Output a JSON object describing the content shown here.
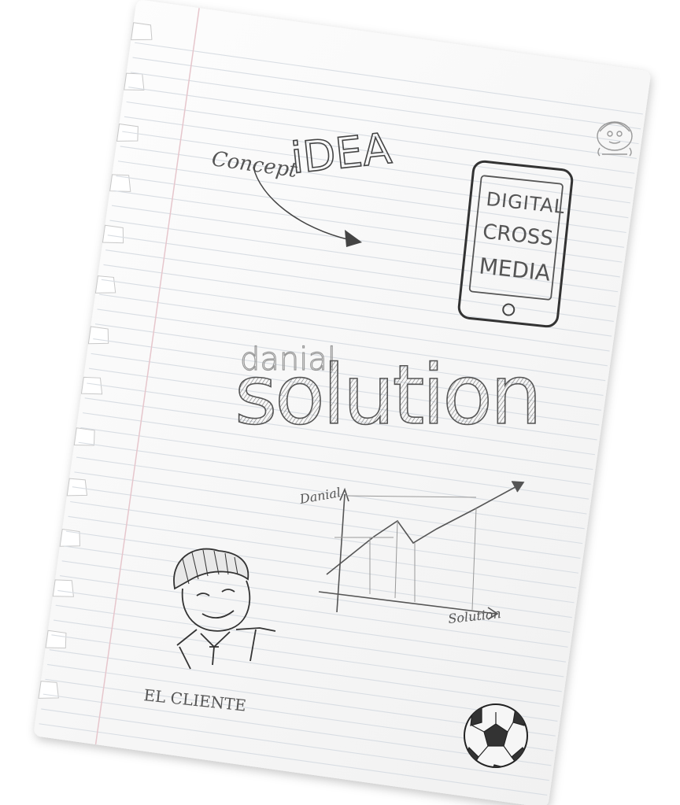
{
  "sheet": {
    "paper_color": "#fbfbfb",
    "rule_color": "#d8dde3",
    "margin_color": "#e6c6cc",
    "ink_color": "#555555"
  },
  "idea_sketch": {
    "concept_label": "Concept",
    "idea_label": "iDEA"
  },
  "phone_sketch": {
    "line1": "DIGITAL",
    "line2": "CROSS",
    "line3": "MEDIA"
  },
  "logo": {
    "small_text": "danial",
    "big_text": "solution"
  },
  "chart_doodle": {
    "y_label": "Danial",
    "x_label": "Solution"
  },
  "client_sketch": {
    "caption": "EL CLIENTE"
  },
  "icons": [
    "cartman-icon",
    "soccer-ball-icon"
  ]
}
